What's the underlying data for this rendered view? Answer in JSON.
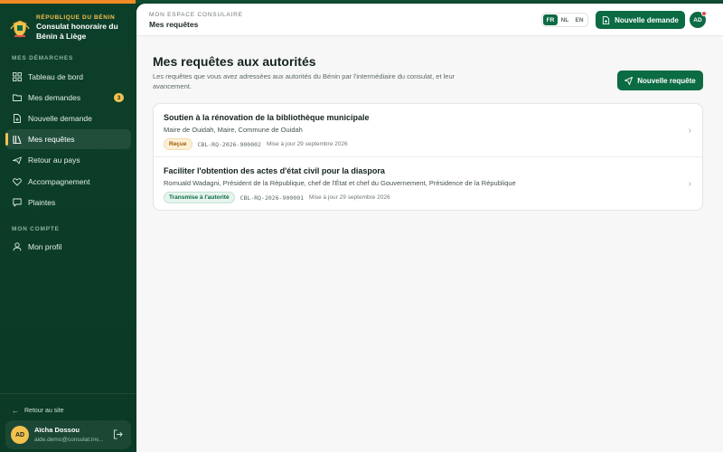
{
  "colors": {
    "brand_green": "#0b6b43",
    "sidebar_bg": "#0c3f29",
    "accent_gold": "#f2c14e",
    "accent_orange": "#f08a24"
  },
  "brand": {
    "kicker": "RÉPUBLIQUE DU BÉNIN",
    "title": "Consulat honoraire du Bénin à Liège"
  },
  "sidebar": {
    "section_demarches": "MES DÉMARCHES",
    "items": [
      {
        "label": "Tableau de bord",
        "icon": "dashboard-icon"
      },
      {
        "label": "Mes demandes",
        "icon": "folder-icon",
        "badge": "3"
      },
      {
        "label": "Nouvelle demande",
        "icon": "file-plus-icon"
      },
      {
        "label": "Mes requêtes",
        "icon": "library-icon",
        "active": true
      },
      {
        "label": "Retour au pays",
        "icon": "plane-icon"
      },
      {
        "label": "Accompagnement",
        "icon": "handshake-icon"
      },
      {
        "label": "Plaintes",
        "icon": "message-icon"
      }
    ],
    "section_compte": "MON COMPTE",
    "account_items": [
      {
        "label": "Mon profil",
        "icon": "user-icon"
      }
    ],
    "back_link": "Retour au site",
    "user": {
      "initials": "AD",
      "name": "Aïcha Dossou",
      "email": "aide.demo@consulat.inv..."
    }
  },
  "topbar": {
    "kicker": "MON ESPACE CONSULAIRE",
    "title": "Mes requêtes",
    "languages": [
      "FR",
      "NL",
      "EN"
    ],
    "active_language": "FR",
    "new_demand_label": "Nouvelle demande",
    "avatar_initials": "AD"
  },
  "page": {
    "title": "Mes requêtes aux autorités",
    "subtitle": "Les requêtes que vous avez adressées aux autorités du Bénin par l'intermédiaire du consulat, et leur avancement.",
    "new_request_label": "Nouvelle requête"
  },
  "requests": [
    {
      "title": "Soutien à la rénovation de la bibliothèque municipale",
      "recipient": "Maire de Ouidah, Maire, Commune de Ouidah",
      "status": "Reçue",
      "reference": "CBL-RQ-2026-900002",
      "updated": "Mise à jour 29 septembre 2026"
    },
    {
      "title": "Faciliter l'obtention des actes d'état civil pour la diaspora",
      "recipient": "Romuald Wadagni, Président de la République, chef de l'État et chef du Gouvernement, Présidence de la République",
      "status": "Transmise à l'autorité",
      "reference": "CBL-RQ-2026-900001",
      "updated": "Mise à jour 29 septembre 2026"
    }
  ]
}
